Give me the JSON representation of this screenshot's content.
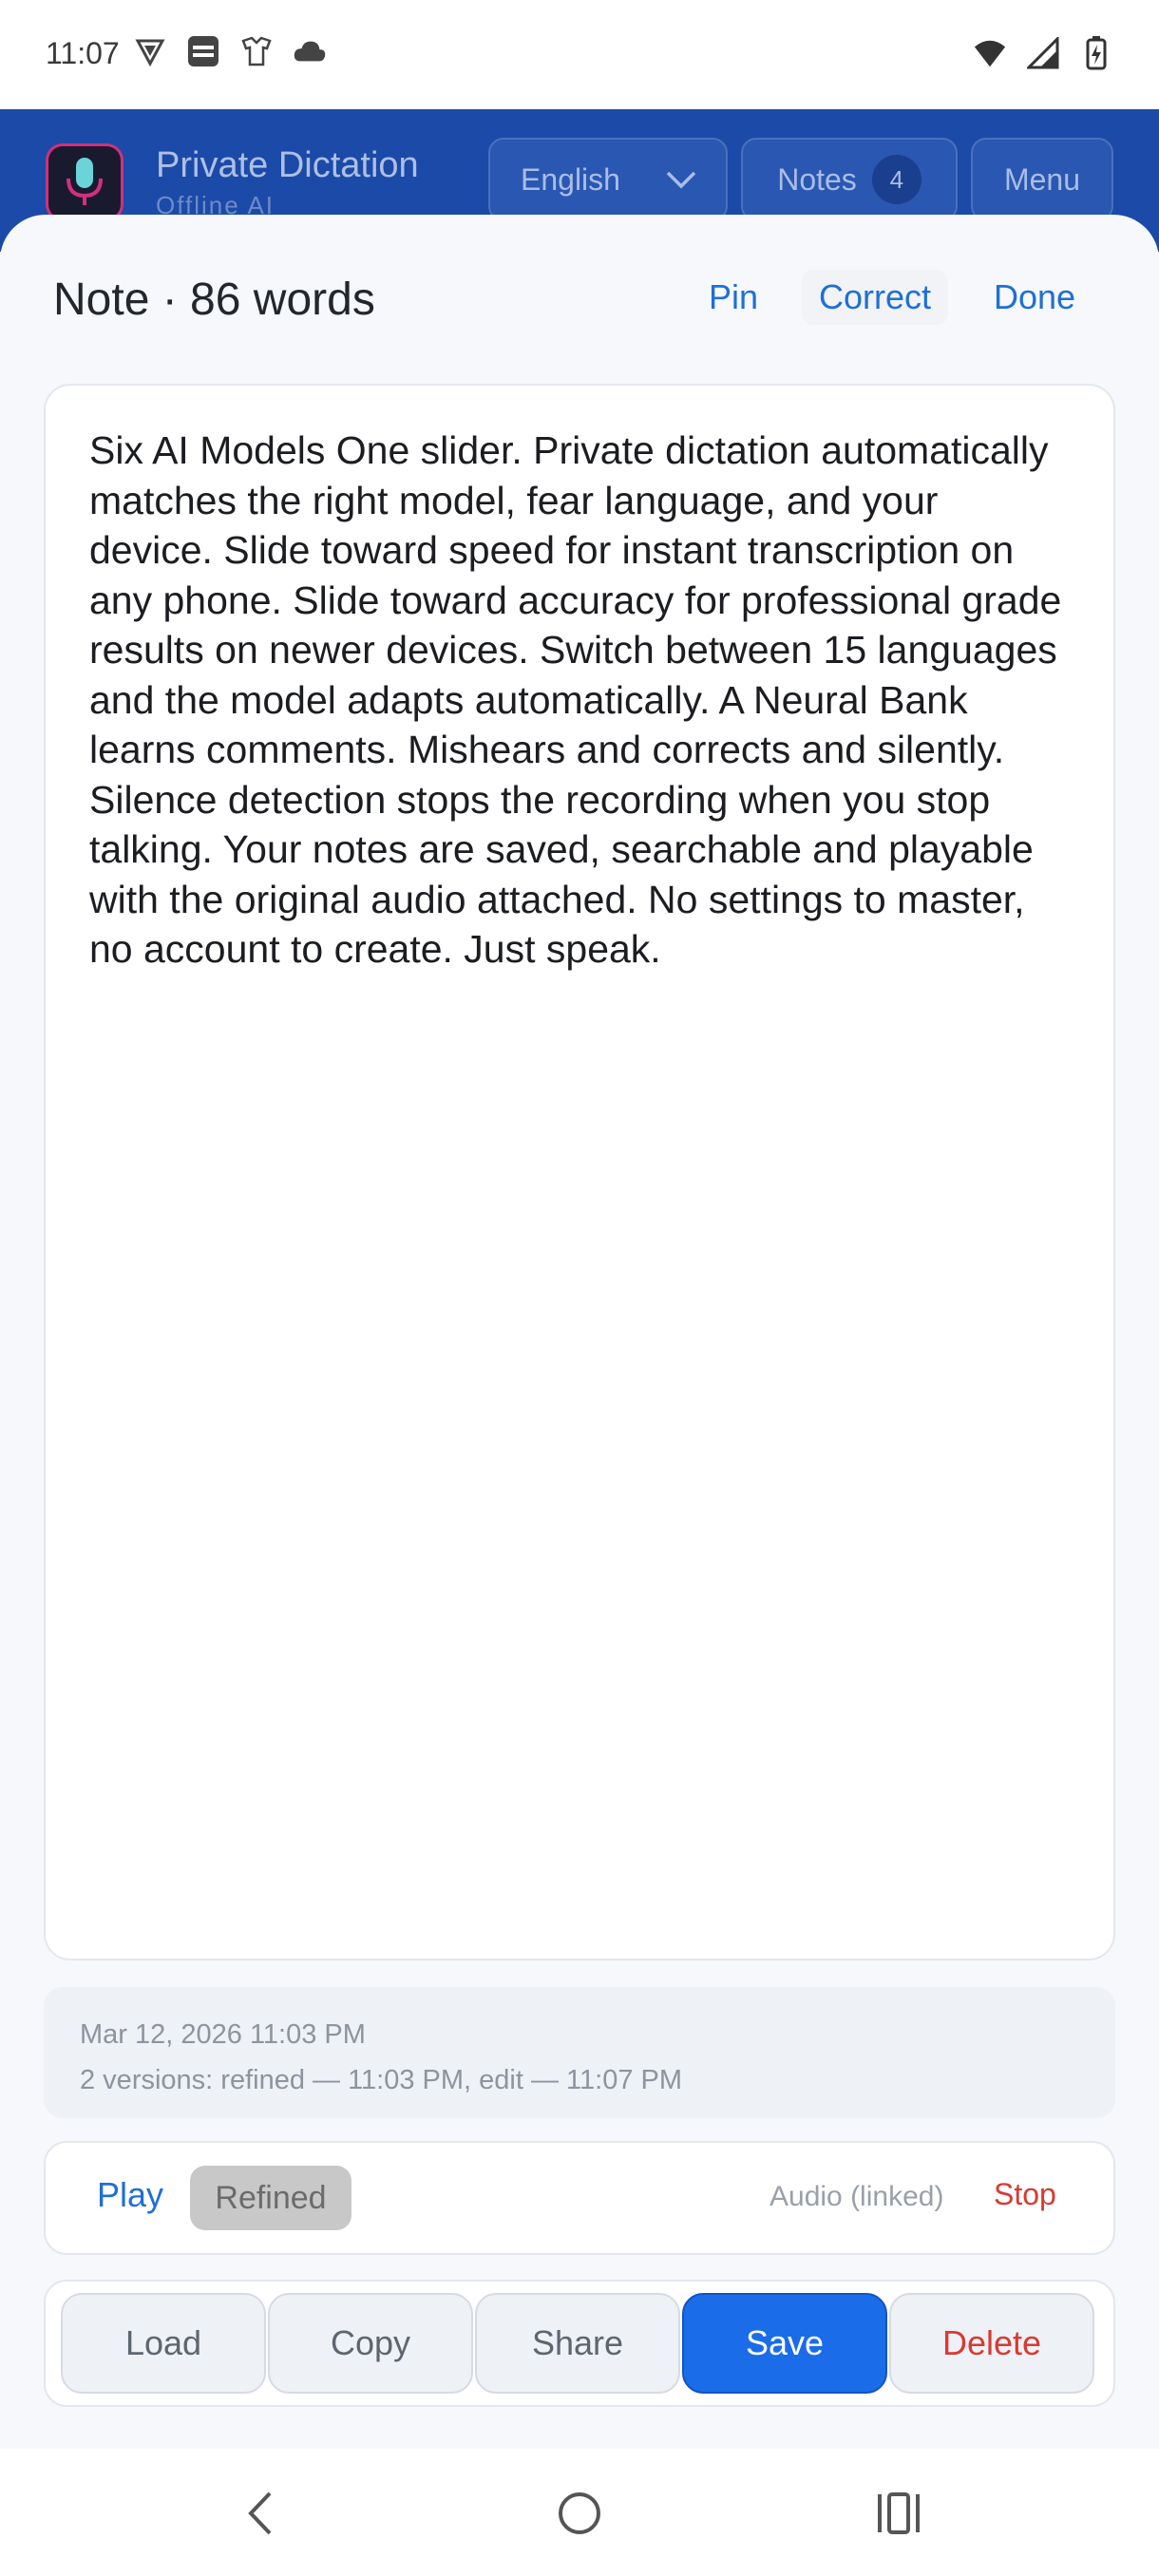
{
  "status_bar": {
    "time": "11:07",
    "left_icons": [
      "vpn-shield-icon",
      "free-stuff-icon",
      "shirt-icon",
      "cloud-icon"
    ],
    "right_icons": [
      "wifi-icon",
      "signal-icon",
      "battery-icon"
    ]
  },
  "app_header": {
    "title": "Private Dictation",
    "subtitle": "Offline AI",
    "language": "English",
    "notes_label": "Notes",
    "notes_count": "4",
    "menu_label": "Menu"
  },
  "sheet": {
    "title": "Note · 86 words",
    "pin_label": "Pin",
    "correct_label": "Correct",
    "done_label": "Done"
  },
  "note": {
    "text": "Six AI Models One slider. Private dictation automatically matches the right model, fear language, and your device. Slide toward speed for instant transcription on any phone. Slide toward accuracy for professional grade results on newer devices. Switch between 15 languages and the model adapts automatically. A Neural Bank learns comments. Mishears and corrects and silently. Silence detection stops the recording when you stop talking. Your notes are saved, searchable and playable with the original audio attached. No settings to master, no account to create. Just speak."
  },
  "meta": {
    "date": "Mar 12, 2026  11:03 PM",
    "versions": "2 versions: refined — 11:03 PM, edit — 11:07 PM"
  },
  "playback": {
    "play_label": "Play",
    "refined_label": "Refined",
    "audio_label": "Audio (linked)",
    "stop_label": "Stop"
  },
  "actions": {
    "load": "Load",
    "copy": "Copy",
    "share": "Share",
    "save": "Save",
    "delete": "Delete"
  },
  "colors": {
    "accent": "#1a6ce8",
    "link": "#1f6fd6",
    "danger": "#d83a32",
    "header": "#1b4aa8"
  }
}
